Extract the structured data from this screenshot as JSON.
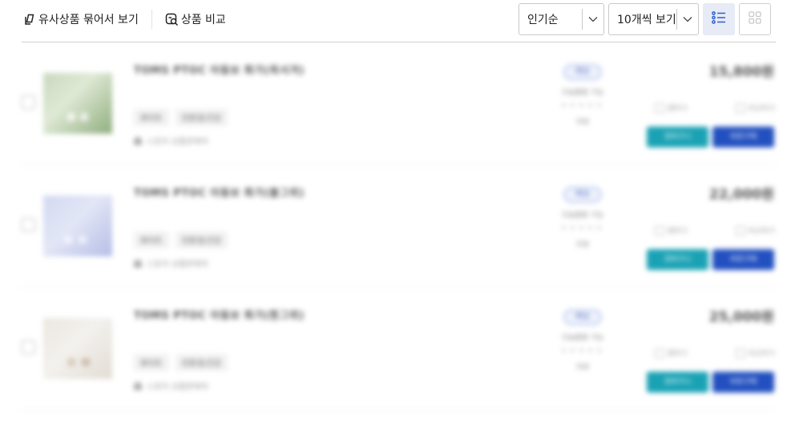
{
  "toolbar": {
    "group_similar_label": "유사상품 묶어서 보기",
    "compare_label": "상품 비교",
    "sort": {
      "selected": "인기순"
    },
    "per_page": {
      "selected": "10개씩 보기"
    },
    "view_mode": "list",
    "accent_color": "#e6ebf6"
  },
  "products": [
    {
      "name": "TOMS PTOC 아동보 화가(최서겨)",
      "tags": [
        "화이트",
        "친환경/건강"
      ],
      "seller": "스토어 상품판매처",
      "badge": "배송",
      "delivery": "오늘출발 가능",
      "stars": "★★★★★",
      "reviews": "리뷰",
      "price": "15,800원",
      "wish_label": "찜하기",
      "compare_label": "비교하기",
      "cart_label": "장바구니",
      "buy_label": "바로구매",
      "thumb_colors": [
        "#dfe9d5",
        "#8fae7e",
        "#c9d8bd"
      ]
    },
    {
      "name": "TOMS PTOC 아동보 화가(블그위)",
      "tags": [
        "화이트",
        "친환경/건강"
      ],
      "seller": "스토어 상품판매처",
      "badge": "배송",
      "delivery": "오늘출발 가능",
      "stars": "★★★★★",
      "reviews": "리뷰",
      "price": "22,000원",
      "wish_label": "찜하기",
      "compare_label": "비교하기",
      "cart_label": "장바구니",
      "buy_label": "바로구매",
      "thumb_colors": [
        "#e2e6f6",
        "#b5bde6",
        "#d3d9f1"
      ]
    },
    {
      "name": "TOMS PTOC 아동보 화가(흰그위)",
      "tags": [
        "화이트",
        "친환경/건강"
      ],
      "seller": "스토어 상품판매처",
      "badge": "배송",
      "delivery": "오늘출발 가능",
      "stars": "★★★★★",
      "reviews": "리뷰",
      "price": "25,000원",
      "wish_label": "찜하기",
      "compare_label": "비교하기",
      "cart_label": "장바구니",
      "buy_label": "바로구매",
      "thumb_colors": [
        "#f3f1ee",
        "#d9cdbd",
        "#ebe6df"
      ]
    }
  ]
}
